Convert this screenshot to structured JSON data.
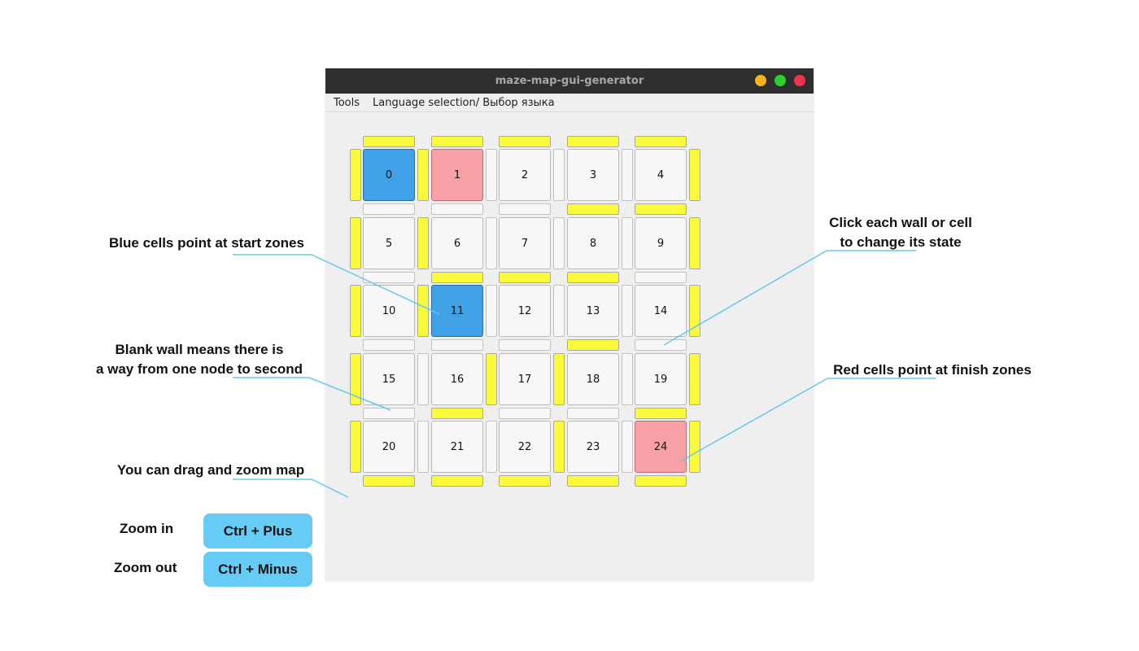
{
  "window": {
    "title": "maze-map-gui-generator",
    "controls": [
      {
        "name": "minimize",
        "color": "#f4b41a"
      },
      {
        "name": "maximize",
        "color": "#2bd12b"
      },
      {
        "name": "close",
        "color": "#f0324b"
      }
    ]
  },
  "menu": {
    "items": [
      "Tools",
      "Language selection/ Выбор языка"
    ]
  },
  "maze": {
    "colors": {
      "start": "#3fa2e6",
      "finish": "#f7a0a6",
      "normal": "#f7f7f7",
      "wall_on": "#fafa3c",
      "wall_off": "#f7f7f7"
    },
    "rows": 5,
    "cols": 5,
    "cells": [
      {
        "id": "0",
        "state": "start"
      },
      {
        "id": "1",
        "state": "finish"
      },
      {
        "id": "2",
        "state": "normal"
      },
      {
        "id": "3",
        "state": "normal"
      },
      {
        "id": "4",
        "state": "normal"
      },
      {
        "id": "5",
        "state": "normal"
      },
      {
        "id": "6",
        "state": "normal"
      },
      {
        "id": "7",
        "state": "normal"
      },
      {
        "id": "8",
        "state": "normal"
      },
      {
        "id": "9",
        "state": "normal"
      },
      {
        "id": "10",
        "state": "normal"
      },
      {
        "id": "11",
        "state": "start"
      },
      {
        "id": "12",
        "state": "normal"
      },
      {
        "id": "13",
        "state": "normal"
      },
      {
        "id": "14",
        "state": "normal"
      },
      {
        "id": "15",
        "state": "normal"
      },
      {
        "id": "16",
        "state": "normal"
      },
      {
        "id": "17",
        "state": "normal"
      },
      {
        "id": "18",
        "state": "normal"
      },
      {
        "id": "19",
        "state": "normal"
      },
      {
        "id": "20",
        "state": "normal"
      },
      {
        "id": "21",
        "state": "normal"
      },
      {
        "id": "22",
        "state": "normal"
      },
      {
        "id": "23",
        "state": "normal"
      },
      {
        "id": "24",
        "state": "finish"
      }
    ],
    "h_walls": [
      [
        1,
        1,
        1,
        1,
        1
      ],
      [
        0,
        0,
        0,
        1,
        1
      ],
      [
        0,
        1,
        1,
        1,
        0
      ],
      [
        0,
        0,
        0,
        1,
        0
      ],
      [
        0,
        1,
        0,
        0,
        1
      ],
      [
        1,
        1,
        1,
        1,
        1
      ]
    ],
    "v_walls": [
      [
        1,
        1,
        0,
        0,
        0,
        1
      ],
      [
        1,
        1,
        0,
        0,
        0,
        1
      ],
      [
        1,
        1,
        0,
        0,
        0,
        1
      ],
      [
        1,
        0,
        1,
        1,
        0,
        1
      ],
      [
        1,
        0,
        0,
        1,
        0,
        1
      ]
    ]
  },
  "annotations": {
    "blue": "Blue cells point at start zones",
    "click_1": "Click each wall or cell",
    "click_2": "to change its state",
    "blank_1": "Blank wall means there is",
    "blank_2": "a way from one node to second",
    "red": "Red cells point at finish zones",
    "drag": "You can drag and zoom map",
    "line_color": "#66c8ee"
  },
  "shortcuts": {
    "zoom_in_label": "Zoom in",
    "zoom_in_keys": "Ctrl + Plus",
    "zoom_out_label": "Zoom out",
    "zoom_out_keys": "Ctrl + Minus",
    "key_color": "#66ccf5"
  }
}
